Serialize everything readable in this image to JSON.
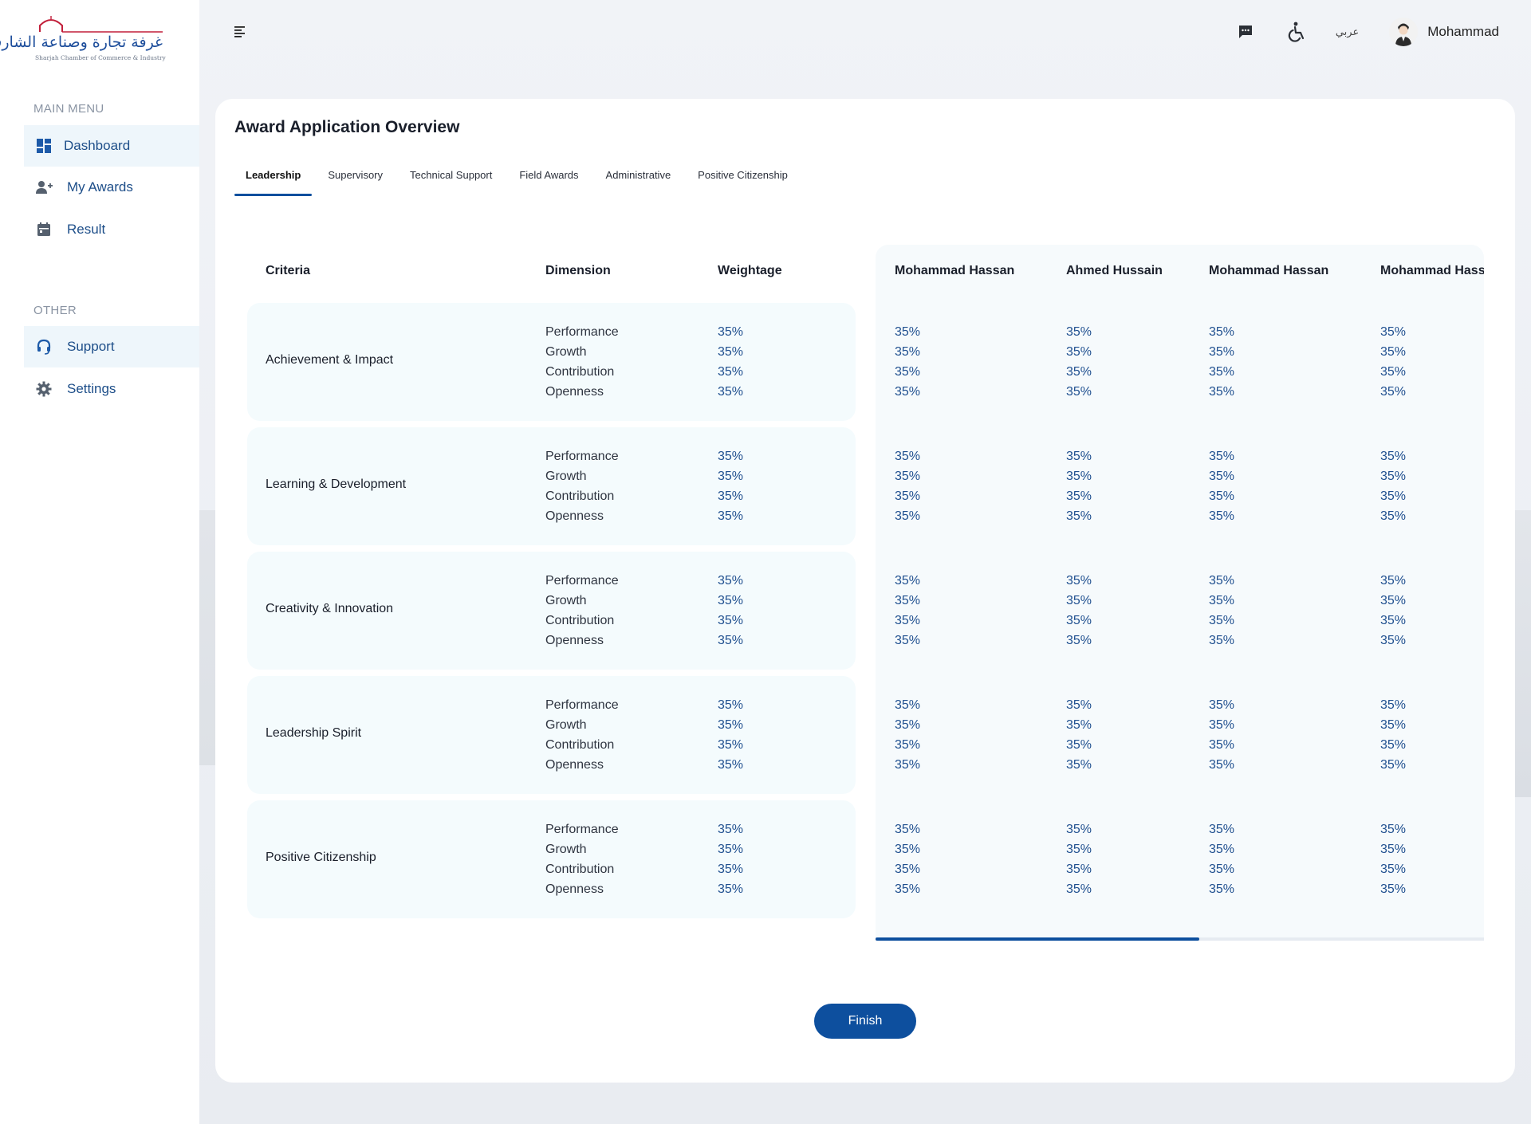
{
  "logo": {
    "arabic": "غرفة تجارة وصناعة الشارقة",
    "english": "Sharjah Chamber of Commerce & Industry"
  },
  "sidebar": {
    "main_menu_title": "MAIN MENU",
    "main_items": [
      {
        "label": "Dashboard",
        "icon": "dashboard-icon"
      },
      {
        "label": "My Awards",
        "icon": "add-user-icon"
      },
      {
        "label": "Result",
        "icon": "calendar-icon"
      }
    ],
    "other_title": "OTHER",
    "other_items": [
      {
        "label": "Support",
        "icon": "headset-icon"
      },
      {
        "label": "Settings",
        "icon": "gear-icon"
      }
    ]
  },
  "topbar": {
    "language": "عربي",
    "user_name": "Mohammad",
    "icons": [
      "menu-icon",
      "chat-icon",
      "accessibility-icon",
      "avatar"
    ]
  },
  "page": {
    "title": "Award Application Overview",
    "tabs": [
      "Leadership",
      "Supervisory",
      "Technical Support",
      "Field Awards",
      "Administrative",
      "Positive Citizenship"
    ],
    "active_tab": "Leadership"
  },
  "table": {
    "headers": {
      "criteria": "Criteria",
      "dimension": "Dimension",
      "weightage": "Weightage"
    },
    "judges": [
      "Mohammad Hassan",
      "Ahmed Hussain",
      "Mohammad Hassan",
      "Mohammad Hassan"
    ],
    "rows": [
      {
        "criteria": "Achievement & Impact",
        "dimensions": [
          "Performance",
          "Growth",
          "Contribution",
          "Openness"
        ],
        "weightage": [
          "35%",
          "35%",
          "35%",
          "35%"
        ],
        "scores": [
          [
            "35%",
            "35%",
            "35%",
            "35%"
          ],
          [
            "35%",
            "35%",
            "35%",
            "35%"
          ],
          [
            "35%",
            "35%",
            "35%",
            "35%"
          ],
          [
            "35%",
            "35%",
            "35%",
            "35%"
          ]
        ]
      },
      {
        "criteria": "Learning & Development",
        "dimensions": [
          "Performance",
          "Growth",
          "Contribution",
          "Openness"
        ],
        "weightage": [
          "35%",
          "35%",
          "35%",
          "35%"
        ],
        "scores": [
          [
            "35%",
            "35%",
            "35%",
            "35%"
          ],
          [
            "35%",
            "35%",
            "35%",
            "35%"
          ],
          [
            "35%",
            "35%",
            "35%",
            "35%"
          ],
          [
            "35%",
            "35%",
            "35%",
            "35%"
          ]
        ]
      },
      {
        "criteria": "Creativity & Innovation",
        "dimensions": [
          "Performance",
          "Growth",
          "Contribution",
          "Openness"
        ],
        "weightage": [
          "35%",
          "35%",
          "35%",
          "35%"
        ],
        "scores": [
          [
            "35%",
            "35%",
            "35%",
            "35%"
          ],
          [
            "35%",
            "35%",
            "35%",
            "35%"
          ],
          [
            "35%",
            "35%",
            "35%",
            "35%"
          ],
          [
            "35%",
            "35%",
            "35%",
            "35%"
          ]
        ]
      },
      {
        "criteria": "Leadership Spirit",
        "dimensions": [
          "Performance",
          "Growth",
          "Contribution",
          "Openness"
        ],
        "weightage": [
          "35%",
          "35%",
          "35%",
          "35%"
        ],
        "scores": [
          [
            "35%",
            "35%",
            "35%",
            "35%"
          ],
          [
            "35%",
            "35%",
            "35%",
            "35%"
          ],
          [
            "35%",
            "35%",
            "35%",
            "35%"
          ],
          [
            "35%",
            "35%",
            "35%",
            "35%"
          ]
        ]
      },
      {
        "criteria": "Positive Citizenship",
        "dimensions": [
          "Performance",
          "Growth",
          "Contribution",
          "Openness"
        ],
        "weightage": [
          "35%",
          "35%",
          "35%",
          "35%"
        ],
        "scores": [
          [
            "35%",
            "35%",
            "35%",
            "35%"
          ],
          [
            "35%",
            "35%",
            "35%",
            "35%"
          ],
          [
            "35%",
            "35%",
            "35%",
            "35%"
          ],
          [
            "35%",
            "35%",
            "35%",
            "35%"
          ]
        ]
      }
    ]
  },
  "actions": {
    "finish_label": "Finish"
  },
  "colors": {
    "primary": "#0d4f9e",
    "link": "#1d4e89",
    "row_bg": "#f4fbfd",
    "score_text": "#1f4f8f"
  }
}
